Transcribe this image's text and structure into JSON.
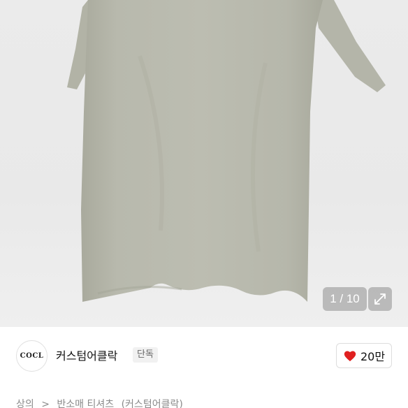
{
  "gallery": {
    "counter": "1 / 10",
    "product_image": "beige short-sleeve knit t-shirt"
  },
  "brand": {
    "logo_text": "COCL",
    "name": "커스텀어클락",
    "badge": "단독"
  },
  "like": {
    "count": "20만",
    "icon": "heart-icon",
    "color": "#e02020"
  },
  "breadcrumb": {
    "items": [
      "상의",
      "반소매 티셔츠",
      "(커스텀어클락)"
    ],
    "separator": ">"
  },
  "colors": {
    "garment": "#b7b8ab",
    "background": "#ebebeb"
  }
}
